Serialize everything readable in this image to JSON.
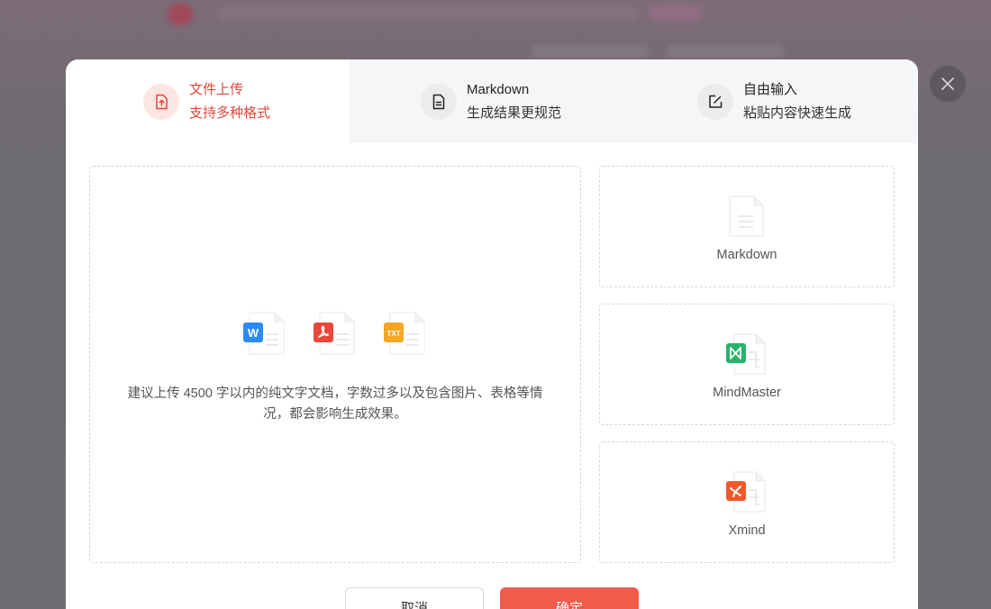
{
  "tabs": [
    {
      "title": "文件上传",
      "subtitle": "支持多种格式",
      "icon": "file-upload-icon",
      "active": true
    },
    {
      "title": "Markdown",
      "subtitle": "生成结果更规范",
      "icon": "document-icon",
      "active": false
    },
    {
      "title": "自由输入",
      "subtitle": "粘贴内容快速生成",
      "icon": "edit-icon",
      "active": false
    }
  ],
  "upload": {
    "file_types": [
      "W",
      "PDF",
      "TXT"
    ],
    "hint": "建议上传 4500 字以内的纯文字文档，字数过多以及包含图片、表格等情况，都会影响生成效果。"
  },
  "formats": [
    {
      "label": "Markdown",
      "icon": "markdown-file-icon"
    },
    {
      "label": "MindMaster",
      "icon": "mindmaster-file-icon"
    },
    {
      "label": "Xmind",
      "icon": "xmind-file-icon"
    }
  ],
  "footer": {
    "cancel_label": "取消",
    "confirm_label": "确定"
  },
  "colors": {
    "accent": "#e0473a",
    "confirm_bg": "#f25a4c",
    "word": "#2b8bf2",
    "pdf": "#e8473a",
    "txt": "#f5a623",
    "mindmaster": "#27b46c",
    "xmind": "#f05a2a"
  }
}
